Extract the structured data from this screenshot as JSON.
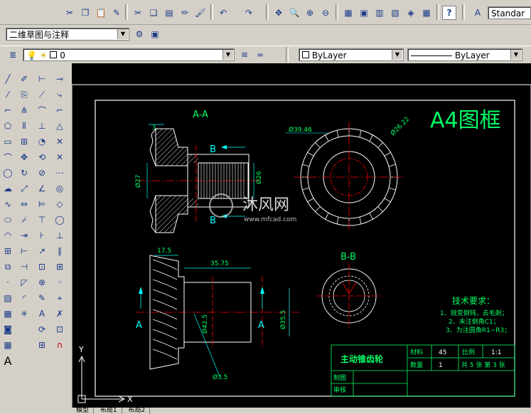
{
  "toolbar": {
    "textstyle_value": "Standar",
    "workspace_value": "二维草图与注释",
    "layer_value": "0",
    "color_value": "ByLayer",
    "linetype_value": "ByLayer"
  },
  "drawing": {
    "frame_title": "A4图框",
    "section_aa": "A-A",
    "section_bb": "B-B",
    "label_b_top": "B",
    "label_b_bottom": "B",
    "label_a_left": "A",
    "label_a_right": "A",
    "dim_3": "3",
    "dim_27": "Ø27",
    "dim_26": "Ø26",
    "dim_39_46": "Ø39.46",
    "dim_26_22": "Ø26.22",
    "dim_17_5": "17.5",
    "dim_35_75": "35.75",
    "dim_42_5": "Ø42.5",
    "dim_35_5": "Ø35.5",
    "dim_3_5": "Ø3.5",
    "tech_title": "技术要求：",
    "tech_lines": [
      "1、锐变倒钝，去毛刺；",
      "2、未注倒角C1；",
      "3、为注圆角R1~R3；"
    ],
    "watermark_text": "沐风网",
    "watermark_url": "www.mfcad.com",
    "axis_x": "X",
    "axis_y": "Y"
  },
  "title_block": {
    "part_name": "主动锥齿轮",
    "material_label": "材料",
    "material_value": "45",
    "scale_label": "比例",
    "scale_value": "1:1",
    "quantity_label": "数量",
    "quantity_value": "1",
    "sheets_label": "共 5 张  第 3 张",
    "drawn_label": "制图",
    "reviewed_label": "审核"
  },
  "tabs": [
    "模型",
    "布局1",
    "布局2"
  ],
  "colors": {
    "canvas_bg": "#000000",
    "line_green": "#00ff00",
    "line_white": "#ffffff",
    "center_red": "#ff0000",
    "dim_cyan": "#00ffff",
    "text_green": "#00ff66"
  }
}
